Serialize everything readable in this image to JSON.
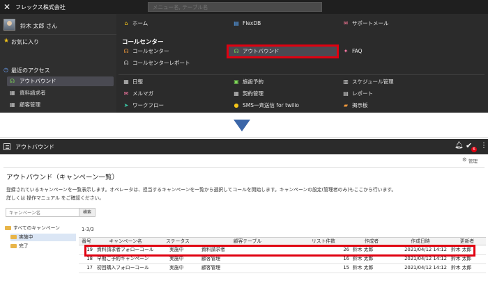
{
  "topbar": {
    "logo_glyph": "✕",
    "company": "フレックス株式会社",
    "search_placeholder": "メニュー名, テーブル名"
  },
  "user": {
    "name": "鈴木 太郎 さん"
  },
  "favorites": {
    "label": "お気に入り"
  },
  "recent": {
    "label": "最近のアクセス",
    "items": [
      {
        "label": "アウトバウンド",
        "icon": "headset-icon"
      },
      {
        "label": "資料請求者",
        "icon": "table-icon"
      },
      {
        "label": "顧客管理",
        "icon": "table-icon"
      }
    ]
  },
  "menu": {
    "row1": [
      {
        "label": "ホーム",
        "icon": "home-icon"
      },
      {
        "label": "FlexDB",
        "icon": "database-icon"
      },
      {
        "label": "サポートメール",
        "icon": "support-mail-icon"
      }
    ],
    "section_title": "コールセンター",
    "callcenter": [
      {
        "label": "コールセンター",
        "icon": "headset-icon"
      },
      {
        "label": "アウトバウンド",
        "icon": "headset-icon"
      },
      {
        "label": "FAQ",
        "icon": "faq-icon"
      },
      {
        "label": "コールセンターレポート",
        "icon": "headset-icon"
      }
    ],
    "bottom": [
      {
        "label": "日報",
        "icon": "report-icon"
      },
      {
        "label": "施設予約",
        "icon": "facility-icon"
      },
      {
        "label": "スケジュール管理",
        "icon": "schedule-icon"
      },
      {
        "label": "メルマガ",
        "icon": "mail-icon"
      },
      {
        "label": "契約管理",
        "icon": "contract-icon"
      },
      {
        "label": "レポート",
        "icon": "report-icon"
      },
      {
        "label": "ワークフロー",
        "icon": "workflow-icon"
      },
      {
        "label": "SMS一斉送信 for twilio",
        "icon": "sms-icon"
      },
      {
        "label": "掲示板",
        "icon": "board-icon"
      }
    ]
  },
  "app": {
    "title": "アウトバウンド",
    "badge_count": "6",
    "admin_label": "管理"
  },
  "page": {
    "title": "アウトバウンド（キャンペーン一覧）",
    "desc_line1": "登録されているキャンペーンを一覧表示します。オペレータは、担当するキャンペーンを一覧から選択してコールを開始します。キャンペーンの設定(管理者のみ)もここから行います。",
    "desc_line2": "詳しくは 操作マニュアル をご確認ください。",
    "search_placeholder": "キャンペーン名",
    "search_button": "検索",
    "count": "1-3/3"
  },
  "tree": {
    "root": "すべてのキャンペーン",
    "children": [
      "実施中",
      "完了"
    ]
  },
  "table": {
    "columns": [
      "番号",
      "キャンペーン名",
      "ステータス",
      "顧客テーブル",
      "リスト件数",
      "作成者",
      "作成日時",
      "更新者"
    ],
    "rows": [
      [
        "19",
        "資料請求者フォローコール",
        "実施中",
        "資料請求者",
        "26",
        "鈴木 太郎",
        "2021/04/12 14:12",
        "鈴木 太郎"
      ],
      [
        "18",
        "早期ご予約キャンペーン",
        "実施中",
        "顧客管理",
        "16",
        "鈴木 太郎",
        "2021/04/12 14:12",
        "鈴木 太郎"
      ],
      [
        "17",
        "初回購入フォローコール",
        "実施中",
        "顧客管理",
        "15",
        "鈴木 太郎",
        "2021/04/12 14:12",
        "鈴木 太郎"
      ]
    ]
  },
  "colors": {
    "menu_bg": "#2b2b2b",
    "highlight_red": "#e00010",
    "arrow_blue": "#3b66a8"
  }
}
